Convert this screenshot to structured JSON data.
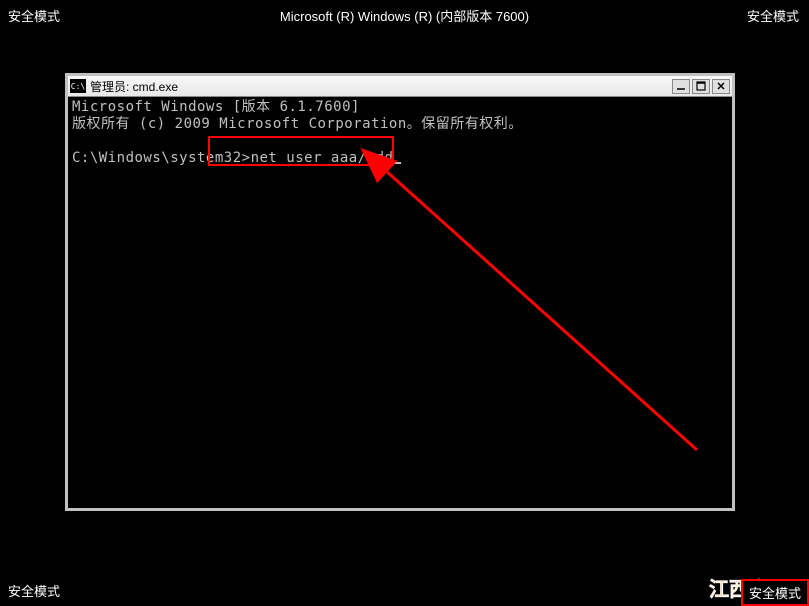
{
  "desktop": {
    "top_center": "Microsoft (R) Windows (R) (内部版本 7600)",
    "corner_label": "安全模式"
  },
  "window": {
    "title": "管理员: cmd.exe",
    "icon_text": "C:\\"
  },
  "cmd": {
    "line1": "Microsoft Windows [版本 6.1.7600]",
    "line2": "版权所有 (c) 2009 Microsoft Corporation。保留所有权利。",
    "prompt": "C:\\Windows\\system32>",
    "command": "net user aaa/add"
  },
  "watermark": {
    "part1": "江西",
    "part2": "龙网"
  }
}
